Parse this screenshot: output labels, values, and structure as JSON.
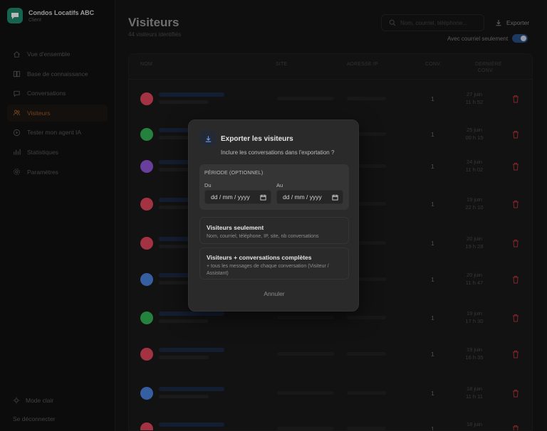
{
  "app": {
    "name": "Condos Locatifs ABC",
    "subtitle": "Client"
  },
  "nav": [
    {
      "label": "Vue d'ensemble",
      "icon": "home-icon"
    },
    {
      "label": "Base de connaissance",
      "icon": "book-icon"
    },
    {
      "label": "Conversations",
      "icon": "chat-icon"
    },
    {
      "label": "Visiteurs",
      "icon": "users-icon",
      "active": true
    },
    {
      "label": "Tester mon agent IA",
      "icon": "play-icon"
    },
    {
      "label": "Statistiques",
      "icon": "chart-icon"
    },
    {
      "label": "Paramètres",
      "icon": "gear-icon"
    }
  ],
  "footer": {
    "theme_label": "Mode clair",
    "logout_label": "Se déconnecter"
  },
  "header": {
    "title": "Visiteurs",
    "subtitle": "44 visiteurs identifiés",
    "search_placeholder": "Nom, courriel, téléphone...",
    "export_label": "Exporter",
    "toggle_label": "Avec courriel seulement"
  },
  "table": {
    "columns": [
      "NOM",
      "SITE",
      "ADRESSE IP",
      "CONV.",
      "DERNIÈRE CONV."
    ],
    "rows": [
      {
        "conv": "1",
        "date": "27 juin",
        "time": "11 h 52",
        "avatar": "#e2475c"
      },
      {
        "conv": "1",
        "date": "25 juin",
        "time": "00 h 15",
        "avatar": "#34b356"
      },
      {
        "conv": "1",
        "date": "24 juin",
        "time": "11 h 02",
        "avatar": "#9457d9"
      },
      {
        "conv": "1",
        "date": "19 juin",
        "time": "22 h 10",
        "avatar": "#e2475c"
      },
      {
        "conv": "1",
        "date": "20 juin",
        "time": "19 h 28",
        "avatar": "#e2475c"
      },
      {
        "conv": "1",
        "date": "20 juin",
        "time": "11 h 47",
        "avatar": "#4c84e0"
      },
      {
        "conv": "1",
        "date": "19 juin",
        "time": "17 h 30",
        "avatar": "#34b356"
      },
      {
        "conv": "1",
        "date": "19 juin",
        "time": "16 h 35",
        "avatar": "#e2475c"
      },
      {
        "conv": "1",
        "date": "18 juin",
        "time": "11 h 11",
        "avatar": "#4c84e0"
      },
      {
        "conv": "1",
        "date": "18 juin",
        "time": "",
        "avatar": "#e2475c"
      }
    ]
  },
  "modal": {
    "title": "Exporter les visiteurs",
    "subtitle": "Inclure les conversations dans l'exportation ?",
    "period_label": "PÉRIODE (OPTIONNEL)",
    "from_label": "Du",
    "to_label": "Au",
    "date_placeholder": "dd / mm / yyyy",
    "option1_title": "Visiteurs seulement",
    "option1_desc": "Nom, courriel, téléphone, IP, site, nb conversations",
    "option2_title": "Visiteurs + conversations complètes",
    "option2_desc": "+ tous les messages de chaque conversation (Visiteur / Assistant)",
    "cancel_label": "Annuler"
  },
  "colors": {
    "accent": "#1f8a6e",
    "active_nav": "#a35a2e",
    "toggle": "#2a4f86",
    "delete": "#b8323a"
  }
}
